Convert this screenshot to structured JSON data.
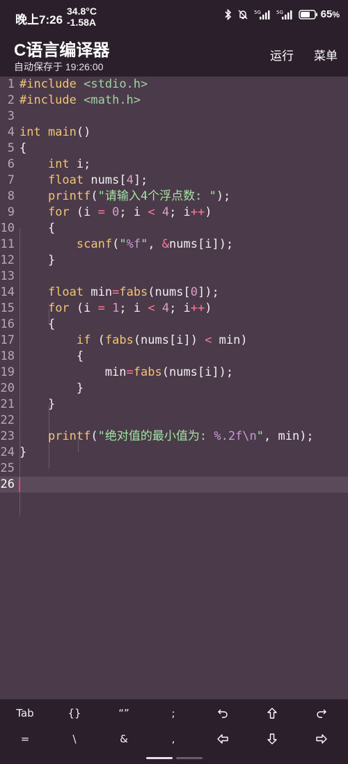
{
  "status": {
    "time": "晚上7:26",
    "temperature": "34.8°C",
    "current": "-1.58A",
    "battery_percent": "65",
    "battery_unit": "%",
    "icons": [
      "bluetooth-icon",
      "mute-bell-icon",
      "signal-5g-icon",
      "signal-5g-icon",
      "battery-icon"
    ]
  },
  "header": {
    "title": "C语言编译器",
    "autosave": "自动保存于 19:26:00",
    "run_label": "运行",
    "menu_label": "菜单"
  },
  "editor": {
    "current_line": "26",
    "lines": [
      {
        "n": "1",
        "text": "#include <stdio.h>"
      },
      {
        "n": "2",
        "text": "#include <math.h>"
      },
      {
        "n": "3",
        "text": ""
      },
      {
        "n": "4",
        "text": "int main()"
      },
      {
        "n": "5",
        "text": "{"
      },
      {
        "n": "6",
        "text": "    int i;"
      },
      {
        "n": "7",
        "text": "    float nums[4];"
      },
      {
        "n": "8",
        "text": "    printf(\"请输入4个浮点数: \");"
      },
      {
        "n": "9",
        "text": "    for (i = 0; i < 4; i++)"
      },
      {
        "n": "10",
        "text": "    {"
      },
      {
        "n": "11",
        "text": "        scanf(\"%f\", &nums[i]);"
      },
      {
        "n": "12",
        "text": "    }"
      },
      {
        "n": "13",
        "text": ""
      },
      {
        "n": "14",
        "text": "    float min=fabs(nums[0]);"
      },
      {
        "n": "15",
        "text": "    for (i = 1; i < 4; i++)"
      },
      {
        "n": "16",
        "text": "    {"
      },
      {
        "n": "17",
        "text": "        if (fabs(nums[i]) < min)"
      },
      {
        "n": "18",
        "text": "        {"
      },
      {
        "n": "19",
        "text": "            min=fabs(nums[i]);"
      },
      {
        "n": "20",
        "text": "        }"
      },
      {
        "n": "21",
        "text": "    }"
      },
      {
        "n": "22",
        "text": ""
      },
      {
        "n": "23",
        "text": "    printf(\"绝对值的最小值为: %.2f\\n\", min);"
      },
      {
        "n": "24",
        "text": "}"
      },
      {
        "n": "25",
        "text": ""
      },
      {
        "n": "26",
        "text": ""
      }
    ]
  },
  "keybar": {
    "row1": [
      "Tab",
      "{}",
      "“”",
      ";",
      "undo",
      "up",
      "redo"
    ],
    "row2": [
      "=",
      "\\",
      "&",
      ",",
      "left",
      "down",
      "right"
    ]
  },
  "colors": {
    "background": "#4a3a4a",
    "bar": "#2b1f2b",
    "keyword": "#f0c674",
    "string": "#a3e3a3",
    "number": "#d8a0c8",
    "operator": "#ff7a9a",
    "cursor": "#ff3c7a"
  }
}
